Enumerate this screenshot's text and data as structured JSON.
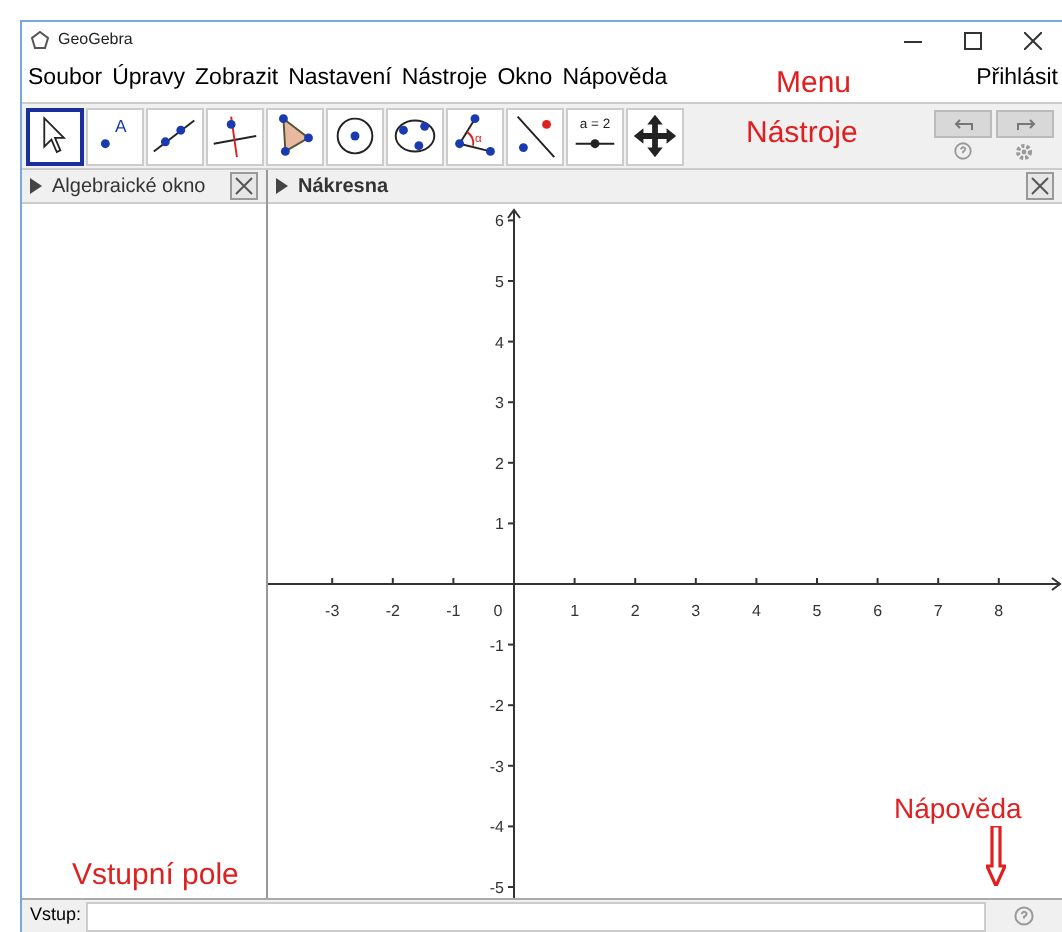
{
  "window": {
    "title": "GeoGebra"
  },
  "menu": {
    "items": [
      "Soubor",
      "Úpravy",
      "Zobrazit",
      "Nastavení",
      "Nástroje",
      "Okno",
      "Nápověda"
    ],
    "sign_in": "Přihlásit"
  },
  "toolbar": {
    "tools": [
      {
        "kind": "pointer",
        "selected": true
      },
      {
        "kind": "point",
        "label": "A",
        "selected": false
      },
      {
        "kind": "line",
        "selected": false
      },
      {
        "kind": "perpendicular",
        "selected": false
      },
      {
        "kind": "polygon",
        "selected": false
      },
      {
        "kind": "circle",
        "selected": false
      },
      {
        "kind": "conic",
        "selected": false
      },
      {
        "kind": "angle",
        "label": "α",
        "selected": false
      },
      {
        "kind": "reflect",
        "selected": false
      },
      {
        "kind": "slider",
        "label": "a = 2",
        "selected": false
      },
      {
        "kind": "move",
        "selected": false
      }
    ]
  },
  "algebra_panel": {
    "title": "Algebraické okno"
  },
  "graphics_panel": {
    "title": "Nákresna",
    "x_labels": [
      "-3",
      "-2",
      "-1",
      "0",
      "1",
      "2",
      "3",
      "4",
      "5",
      "6",
      "7",
      "8"
    ],
    "y_labels": [
      "6",
      "5",
      "4",
      "3",
      "2",
      "1",
      "-1",
      "-2",
      "-3",
      "-4",
      "-5"
    ]
  },
  "input_bar": {
    "label": "Vstup:"
  },
  "annotations": [
    "Menu",
    "Nástroje",
    "Nápověda",
    "Vstupní pole"
  ]
}
